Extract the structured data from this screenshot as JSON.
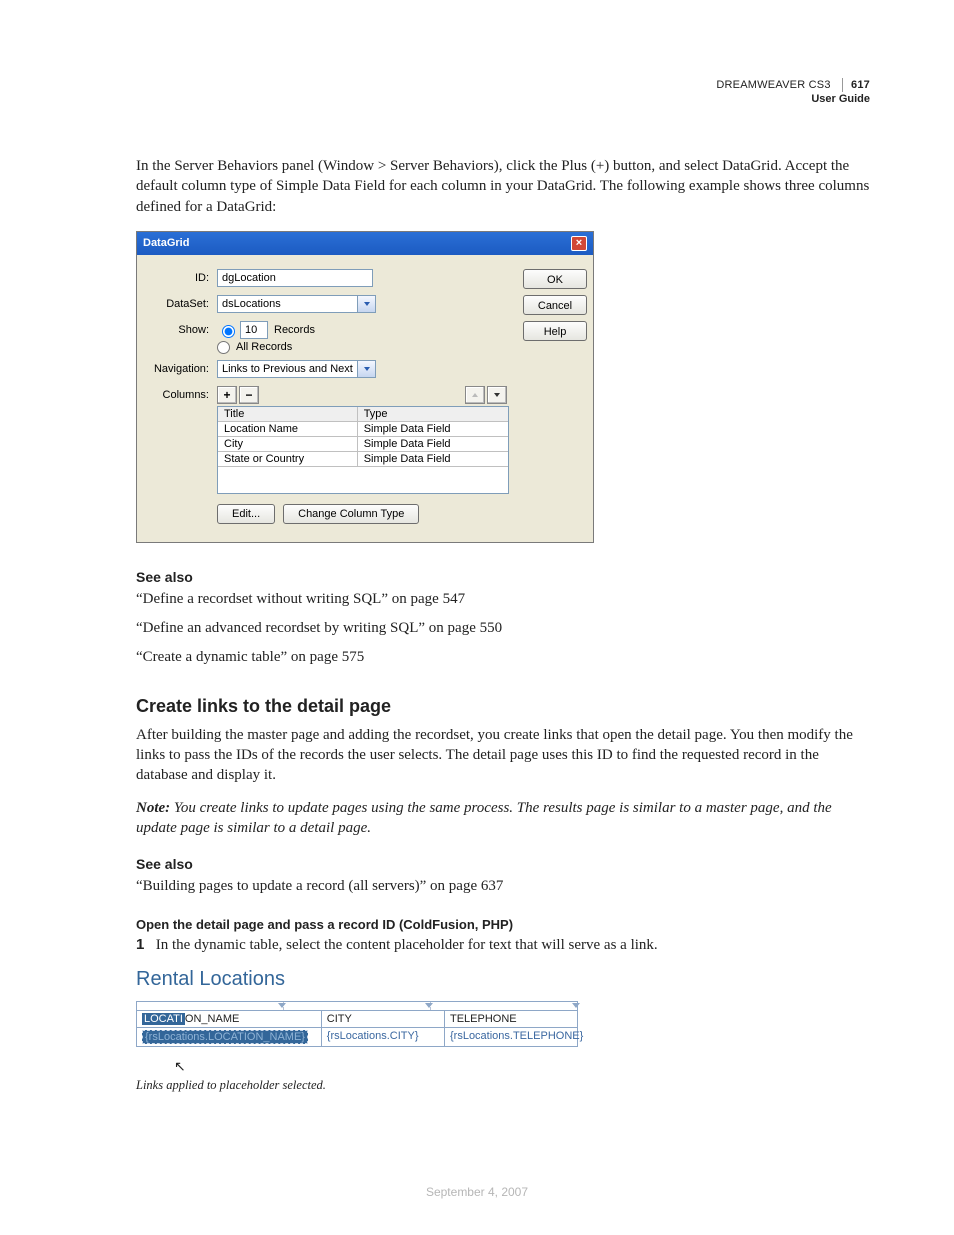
{
  "header": {
    "product": "DREAMWEAVER CS3",
    "page_number": "617",
    "subtitle": "User Guide"
  },
  "intro_paragraph": "In the Server Behaviors panel (Window > Server Behaviors), click the Plus (+) button, and select DataGrid. Accept the default column type of Simple Data Field for each column in your DataGrid. The following example shows three columns defined for a DataGrid:",
  "dialog": {
    "title": "DataGrid",
    "labels": {
      "id": "ID:",
      "dataset": "DataSet:",
      "show": "Show:",
      "records": "Records",
      "all_records": "All Records",
      "navigation": "Navigation:",
      "columns": "Columns:"
    },
    "values": {
      "id": "dgLocation",
      "dataset": "dsLocations",
      "records_num": "10",
      "navigation": "Links to Previous and Next Pages"
    },
    "columns_header": {
      "title": "Title",
      "type": "Type"
    },
    "columns": [
      {
        "title": "Location Name",
        "type": "Simple Data Field"
      },
      {
        "title": "City",
        "type": "Simple Data Field"
      },
      {
        "title": "State or Country",
        "type": "Simple Data Field"
      }
    ],
    "buttons": {
      "ok": "OK",
      "cancel": "Cancel",
      "help": "Help",
      "edit": "Edit...",
      "change_col": "Change Column Type"
    }
  },
  "see_also_1": {
    "heading": "See also",
    "items": [
      "“Define a recordset without writing SQL” on page 547",
      "“Define an advanced recordset by writing SQL” on page 550",
      "“Create a dynamic table” on page 575"
    ]
  },
  "section2": {
    "heading": "Create links to the detail page",
    "para": "After building the master page and adding the recordset, you create links that open the detail page. You then modify the links to pass the IDs of the records the user selects. The detail page uses this ID to find the requested record in the database and display it.",
    "note_label": "Note:",
    "note_body": " You create links to update pages using the same process. The results page is similar to a master page, and the update page is similar to a detail page."
  },
  "see_also_2": {
    "heading": "See also",
    "items": [
      "“Building pages to update a record (all servers)” on page 637"
    ]
  },
  "subsection": {
    "heading": "Open the detail page and pass a record ID (ColdFusion, PHP)",
    "step_num": "1",
    "step_text": "In the dynamic table, select the content placeholder for text that will serve as a link."
  },
  "rental": {
    "title": "Rental Locations",
    "head": {
      "c1_pre": "",
      "c1_sel": "LOCATI",
      "c1_post": "ON_NAME",
      "c2": "CITY",
      "c3": "TELEPHONE"
    },
    "row": {
      "c1": "{rsLocations.LOCATION_NAME}",
      "c2": "{rsLocations.CITY}",
      "c3": "{rsLocations.TELEPHONE}"
    }
  },
  "caption": "Links applied to placeholder selected.",
  "footer_date": "September 4, 2007"
}
